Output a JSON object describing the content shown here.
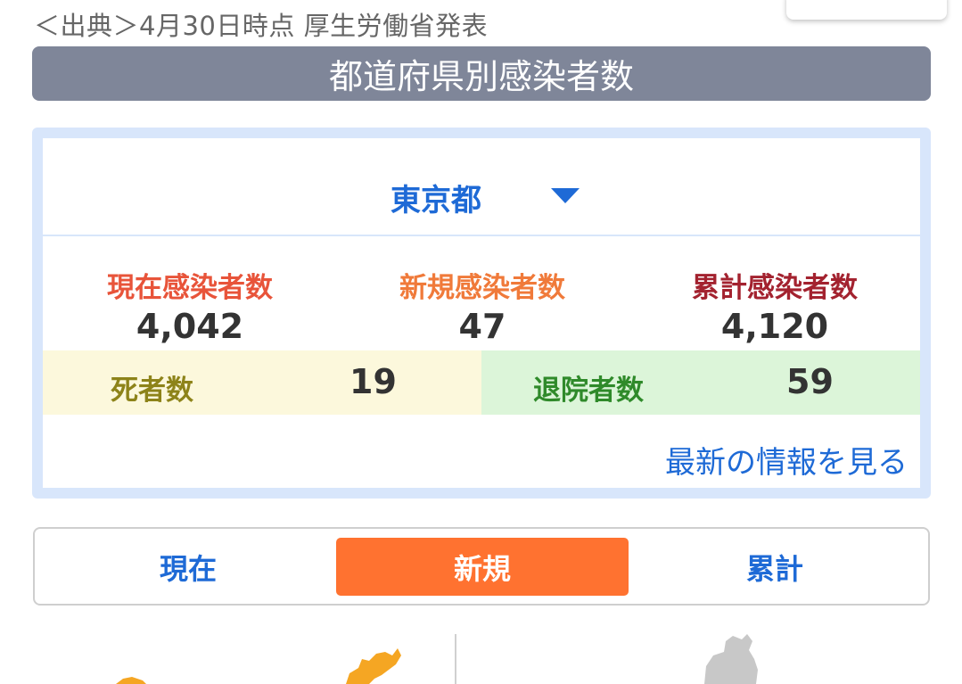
{
  "source_note": "＜出典＞4月30日時点 厚生労働省発表",
  "header": {
    "title": "都道府県別感染者数"
  },
  "prefecture": {
    "selected": "東京都"
  },
  "stats": {
    "current": {
      "label": "現在感染者数",
      "value": "4,042"
    },
    "new": {
      "label": "新規感染者数",
      "value": "47"
    },
    "total": {
      "label": "累計感染者数",
      "value": "4,120"
    }
  },
  "deaths": {
    "label": "死者数",
    "value": "19"
  },
  "discharged": {
    "label": "退院者数",
    "value": "59"
  },
  "latest_link": "最新の情報を見る",
  "view_toggle": {
    "options": [
      "現在",
      "新規",
      "累計"
    ],
    "selected": "新規"
  },
  "colors": {
    "accent_blue": "#1e6ad6",
    "selected_orange": "#ff7230",
    "header_bar": "#7f8699",
    "current_label": "#e8543a",
    "new_label": "#f07a3a",
    "total_label": "#a3222f",
    "deaths_bg": "#fcf8dc",
    "discharged_bg": "#dcf5d9",
    "map_orange": "#f5a623",
    "map_gray": "#c8c8c8"
  },
  "icons": {
    "dropdown": "caret-down-icon"
  }
}
